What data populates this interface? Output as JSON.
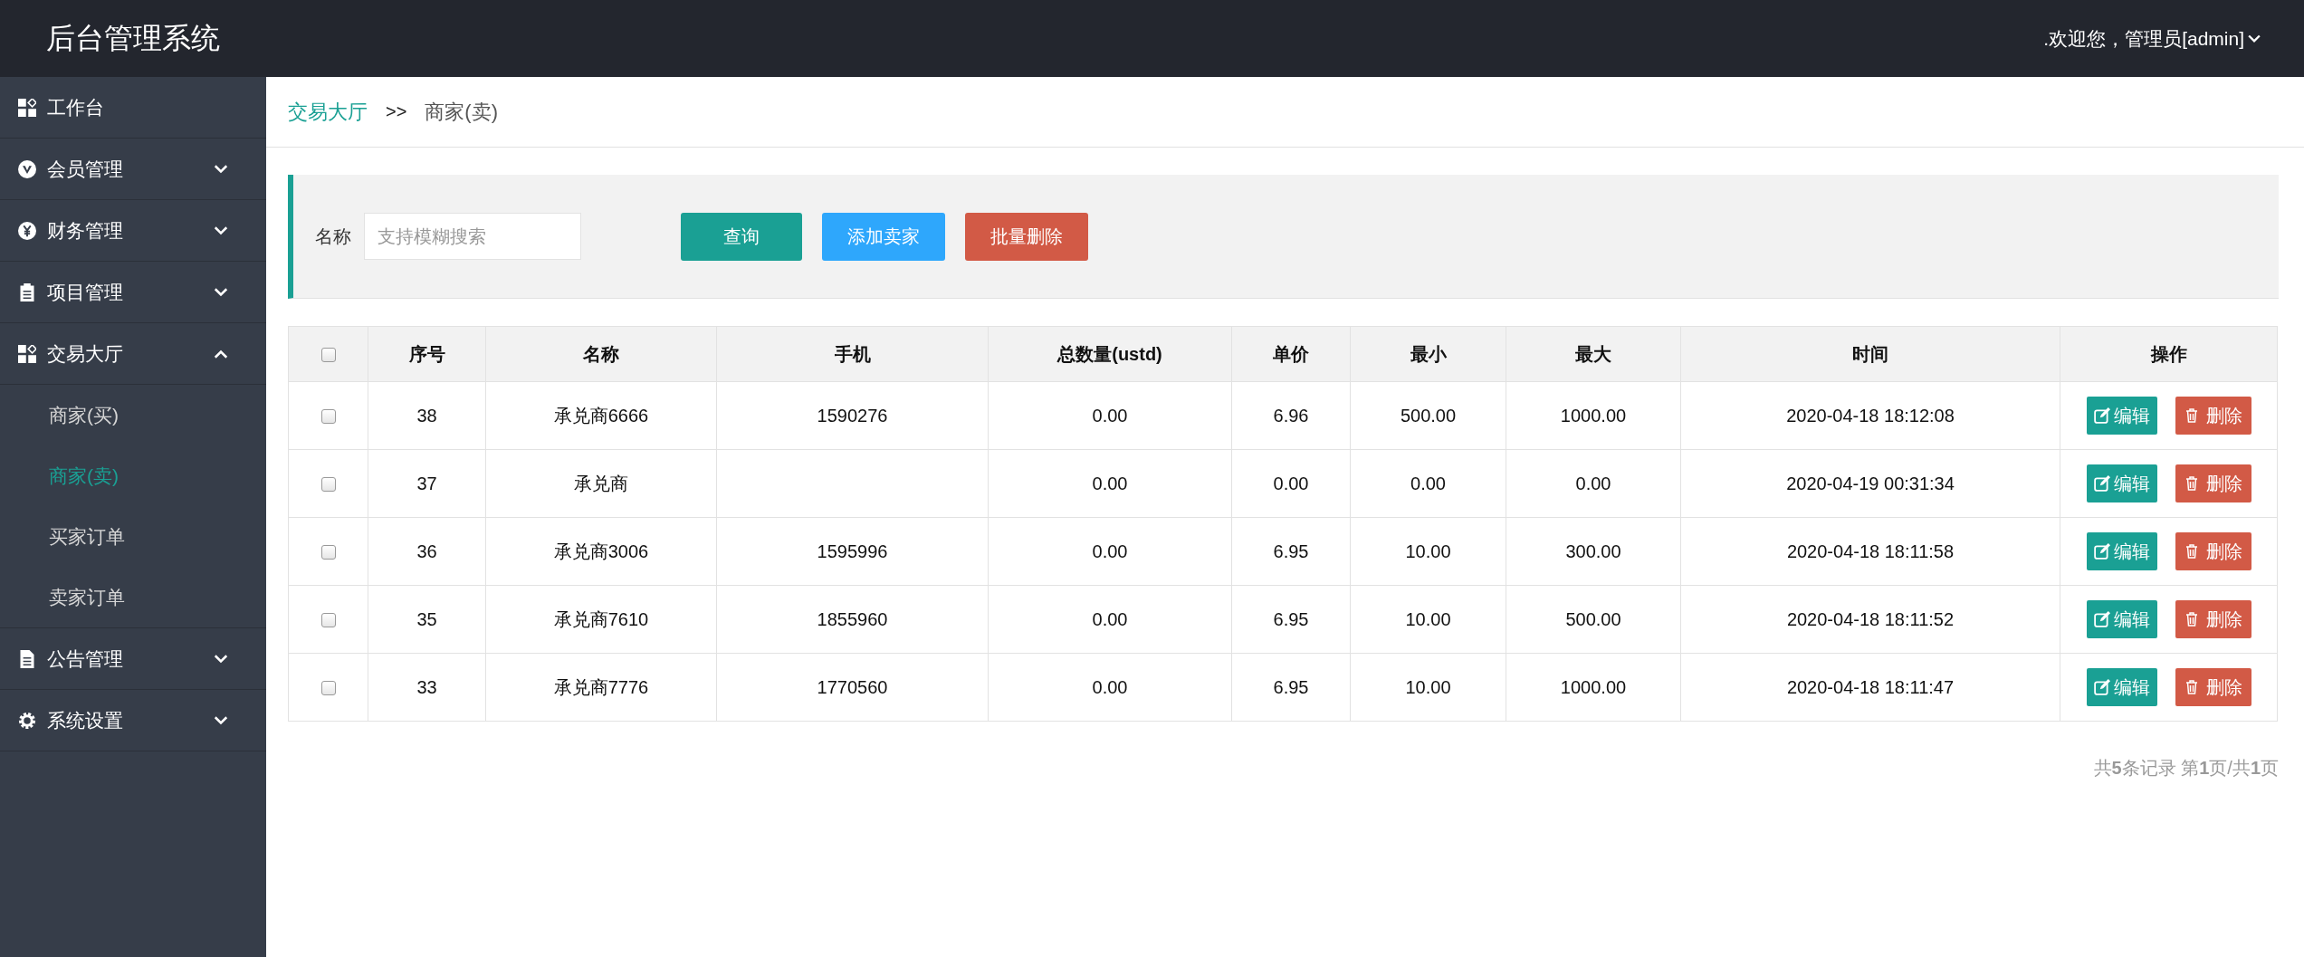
{
  "header": {
    "title": "后台管理系统",
    "user": ".欢迎您，管理员[admin]"
  },
  "sidebar": {
    "items": [
      {
        "label": "工作台",
        "kind": "link"
      },
      {
        "label": "会员管理",
        "kind": "group",
        "expanded": false
      },
      {
        "label": "财务管理",
        "kind": "group",
        "expanded": false
      },
      {
        "label": "项目管理",
        "kind": "group",
        "expanded": false
      },
      {
        "label": "交易大厅",
        "kind": "group",
        "expanded": true,
        "children": [
          {
            "label": "商家(买)",
            "selected": false
          },
          {
            "label": "商家(卖)",
            "selected": true
          },
          {
            "label": "买家订单",
            "selected": false
          },
          {
            "label": "卖家订单",
            "selected": false
          }
        ]
      },
      {
        "label": "公告管理",
        "kind": "group",
        "expanded": false
      },
      {
        "label": "系统设置",
        "kind": "group",
        "expanded": false
      }
    ]
  },
  "breadcrumb": {
    "parent": "交易大厅",
    "separator": ">>",
    "current": "商家(卖)"
  },
  "filter": {
    "label": "名称",
    "placeholder": "支持模糊搜索",
    "buttons": [
      {
        "label": "查询",
        "kind": "primary"
      },
      {
        "label": "添加卖家",
        "kind": "info"
      },
      {
        "label": "批量删除",
        "kind": "danger"
      }
    ]
  },
  "table": {
    "header_checked": false,
    "columns": [
      "序号",
      "名称",
      "手机",
      "总数量(ustd)",
      "单价",
      "最小",
      "最大",
      "时间",
      "操作"
    ],
    "rows": [
      {
        "checked": false,
        "cells": [
          "38",
          "承兑商6666",
          "1590276",
          "0.00",
          "6.96",
          "500.00",
          "1000.00",
          "2020-04-18 18:12:08"
        ],
        "actions": [
          "编辑",
          "删除"
        ]
      },
      {
        "checked": false,
        "cells": [
          "37",
          "承兑商",
          "",
          "0.00",
          "0.00",
          "0.00",
          "0.00",
          "2020-04-19 00:31:34"
        ],
        "actions": [
          "编辑",
          "删除"
        ]
      },
      {
        "checked": false,
        "cells": [
          "36",
          "承兑商3006",
          "1595996",
          "0.00",
          "6.95",
          "10.00",
          "300.00",
          "2020-04-18 18:11:58"
        ],
        "actions": [
          "编辑",
          "删除"
        ]
      },
      {
        "checked": false,
        "cells": [
          "35",
          "承兑商7610",
          "1855960",
          "0.00",
          "6.95",
          "10.00",
          "500.00",
          "2020-04-18 18:11:52"
        ],
        "actions": [
          "编辑",
          "删除"
        ]
      },
      {
        "checked": false,
        "cells": [
          "33",
          "承兑商7776",
          "1770560",
          "0.00",
          "6.95",
          "10.00",
          "1000.00",
          "2020-04-18 18:11:47"
        ],
        "actions": [
          "编辑",
          "删除"
        ]
      }
    ]
  },
  "pagination": "共**5**条记录 第**1**页/共**1**页"
}
